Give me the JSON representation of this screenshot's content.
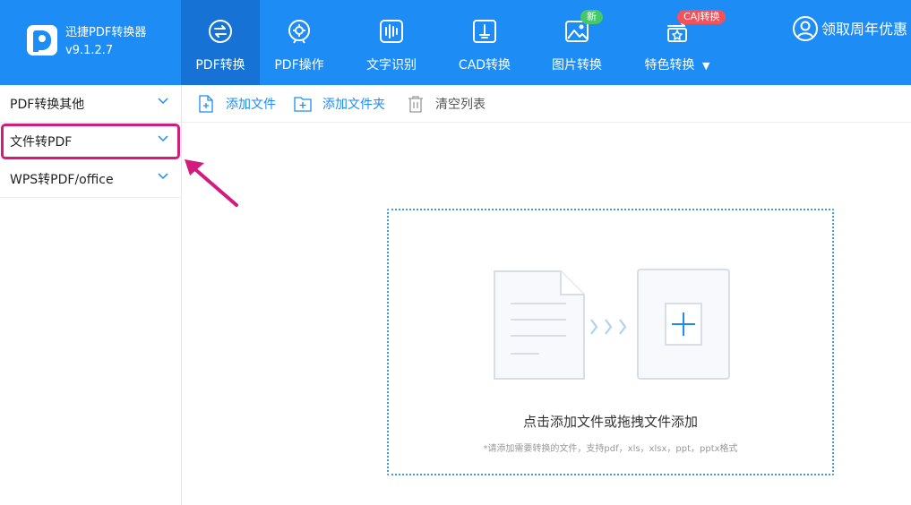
{
  "app": {
    "title": "迅捷PDF转换器",
    "version": "v9.1.2.7"
  },
  "nav": {
    "tabs": [
      {
        "label": "PDF转换",
        "icon": "pdf-convert-icon",
        "active": true
      },
      {
        "label": "PDF操作",
        "icon": "pdf-operate-icon"
      },
      {
        "label": "文字识别",
        "icon": "ocr-icon"
      },
      {
        "label": "CAD转换",
        "icon": "cad-convert-icon"
      },
      {
        "label": "图片转换",
        "icon": "image-convert-icon",
        "badge": "新"
      },
      {
        "label": "特色转换",
        "icon": "special-convert-icon",
        "badge": "CAJ转换",
        "dropdown": true
      }
    ],
    "promo": "领取周年优惠"
  },
  "sidebar": {
    "items": [
      {
        "label": "PDF转换其他"
      },
      {
        "label": "文件转PDF",
        "highlighted": true
      },
      {
        "label": "WPS转PDF/office"
      }
    ]
  },
  "toolbar": {
    "add_file": "添加文件",
    "add_folder": "添加文件夹",
    "clear_list": "清空列表"
  },
  "dropzone": {
    "main_text": "点击添加文件或拖拽文件添加",
    "hint_text": "*请添加需要转换的文件，支持pdf，xls，xlsx，ppt，pptx格式"
  },
  "colors": {
    "brand_blue": "#1e8cf5",
    "active_tab": "#1672d4",
    "highlight_magenta": "#d31b7e",
    "badge_green": "#43c96b",
    "badge_red": "#f4525b"
  }
}
